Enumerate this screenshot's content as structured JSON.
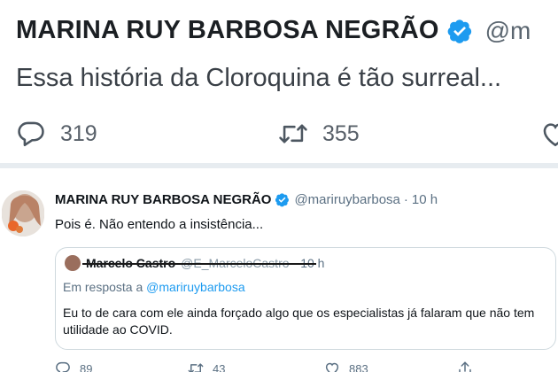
{
  "header_tweet": {
    "author_name": "MARINA RUY BARBOSA NEGRÃO",
    "handle_fragment": "@m",
    "text": "Essa história da Cloroquina é tão surreal...",
    "actions": {
      "reply_count": "319",
      "retweet_count": "355"
    }
  },
  "reply_tweet": {
    "author_name": "MARINA RUY BARBOSA NEGRÃO",
    "handle": "@mariruybarbosa",
    "separator": "·",
    "time": "10 h",
    "text": "Pois é. Não entendo a insistência...",
    "quoted": {
      "author_name": "Marcelo Castro",
      "handle": "@E_MarceloCastro",
      "separator": "·",
      "time": "10 h",
      "reply_prefix": "Em resposta a",
      "reply_handle": "@mariruybarbosa",
      "text": "Eu to de cara com ele ainda forçado algo que os especialistas já falaram que não tem utilidade ao COVID."
    },
    "actions": {
      "reply_count": "89",
      "retweet_count": "43",
      "like_count": "883"
    }
  },
  "colors": {
    "verified": "#1d9bf0",
    "link": "#1d9bf0",
    "muted": "#5b7083",
    "divider": "#e7ecf0"
  },
  "icons": [
    "verified-badge-icon",
    "reply-icon",
    "retweet-icon",
    "like-icon",
    "share-icon"
  ]
}
